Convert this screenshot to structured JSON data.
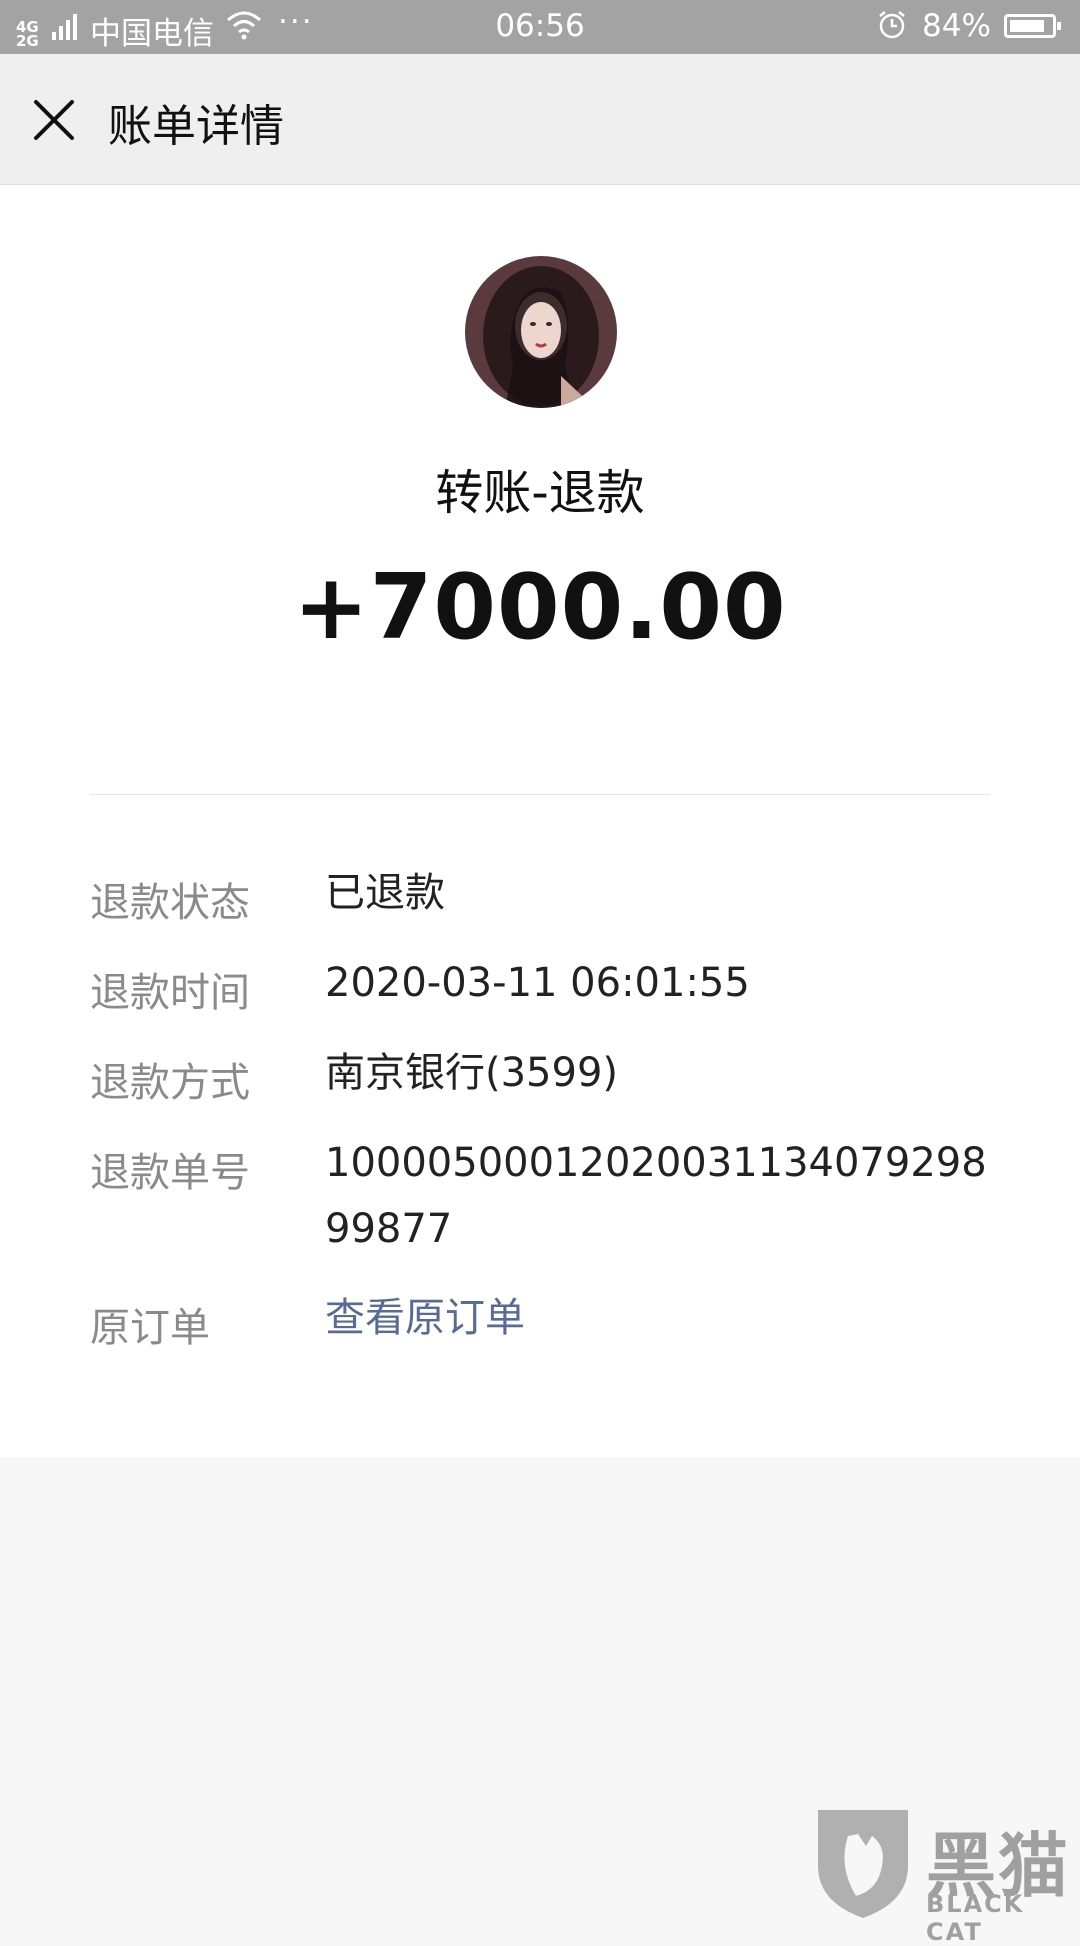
{
  "status_bar": {
    "network": "4G 2G",
    "carrier": "中国电信",
    "more": "···",
    "time": "06:56",
    "battery": "84%",
    "battery_level": 0.84
  },
  "nav": {
    "title": "账单详情"
  },
  "transaction": {
    "title": "转账-退款",
    "amount": "+7000.00"
  },
  "details": [
    {
      "label": "退款状态",
      "value": "已退款"
    },
    {
      "label": "退款时间",
      "value": "2020-03-11 06:01:55"
    },
    {
      "label": "退款方式",
      "value": "南京银行(3599)"
    },
    {
      "label": "退款单号",
      "value": "1000050001202003113407929899877"
    },
    {
      "label": "原订单",
      "value": "查看原订单"
    }
  ],
  "watermark": {
    "text": "黑猫",
    "subtext": "BLACK CAT"
  },
  "colors": {
    "link": "#576b95",
    "label": "#8a8a8a",
    "status_bar": "#a3a3a3"
  }
}
